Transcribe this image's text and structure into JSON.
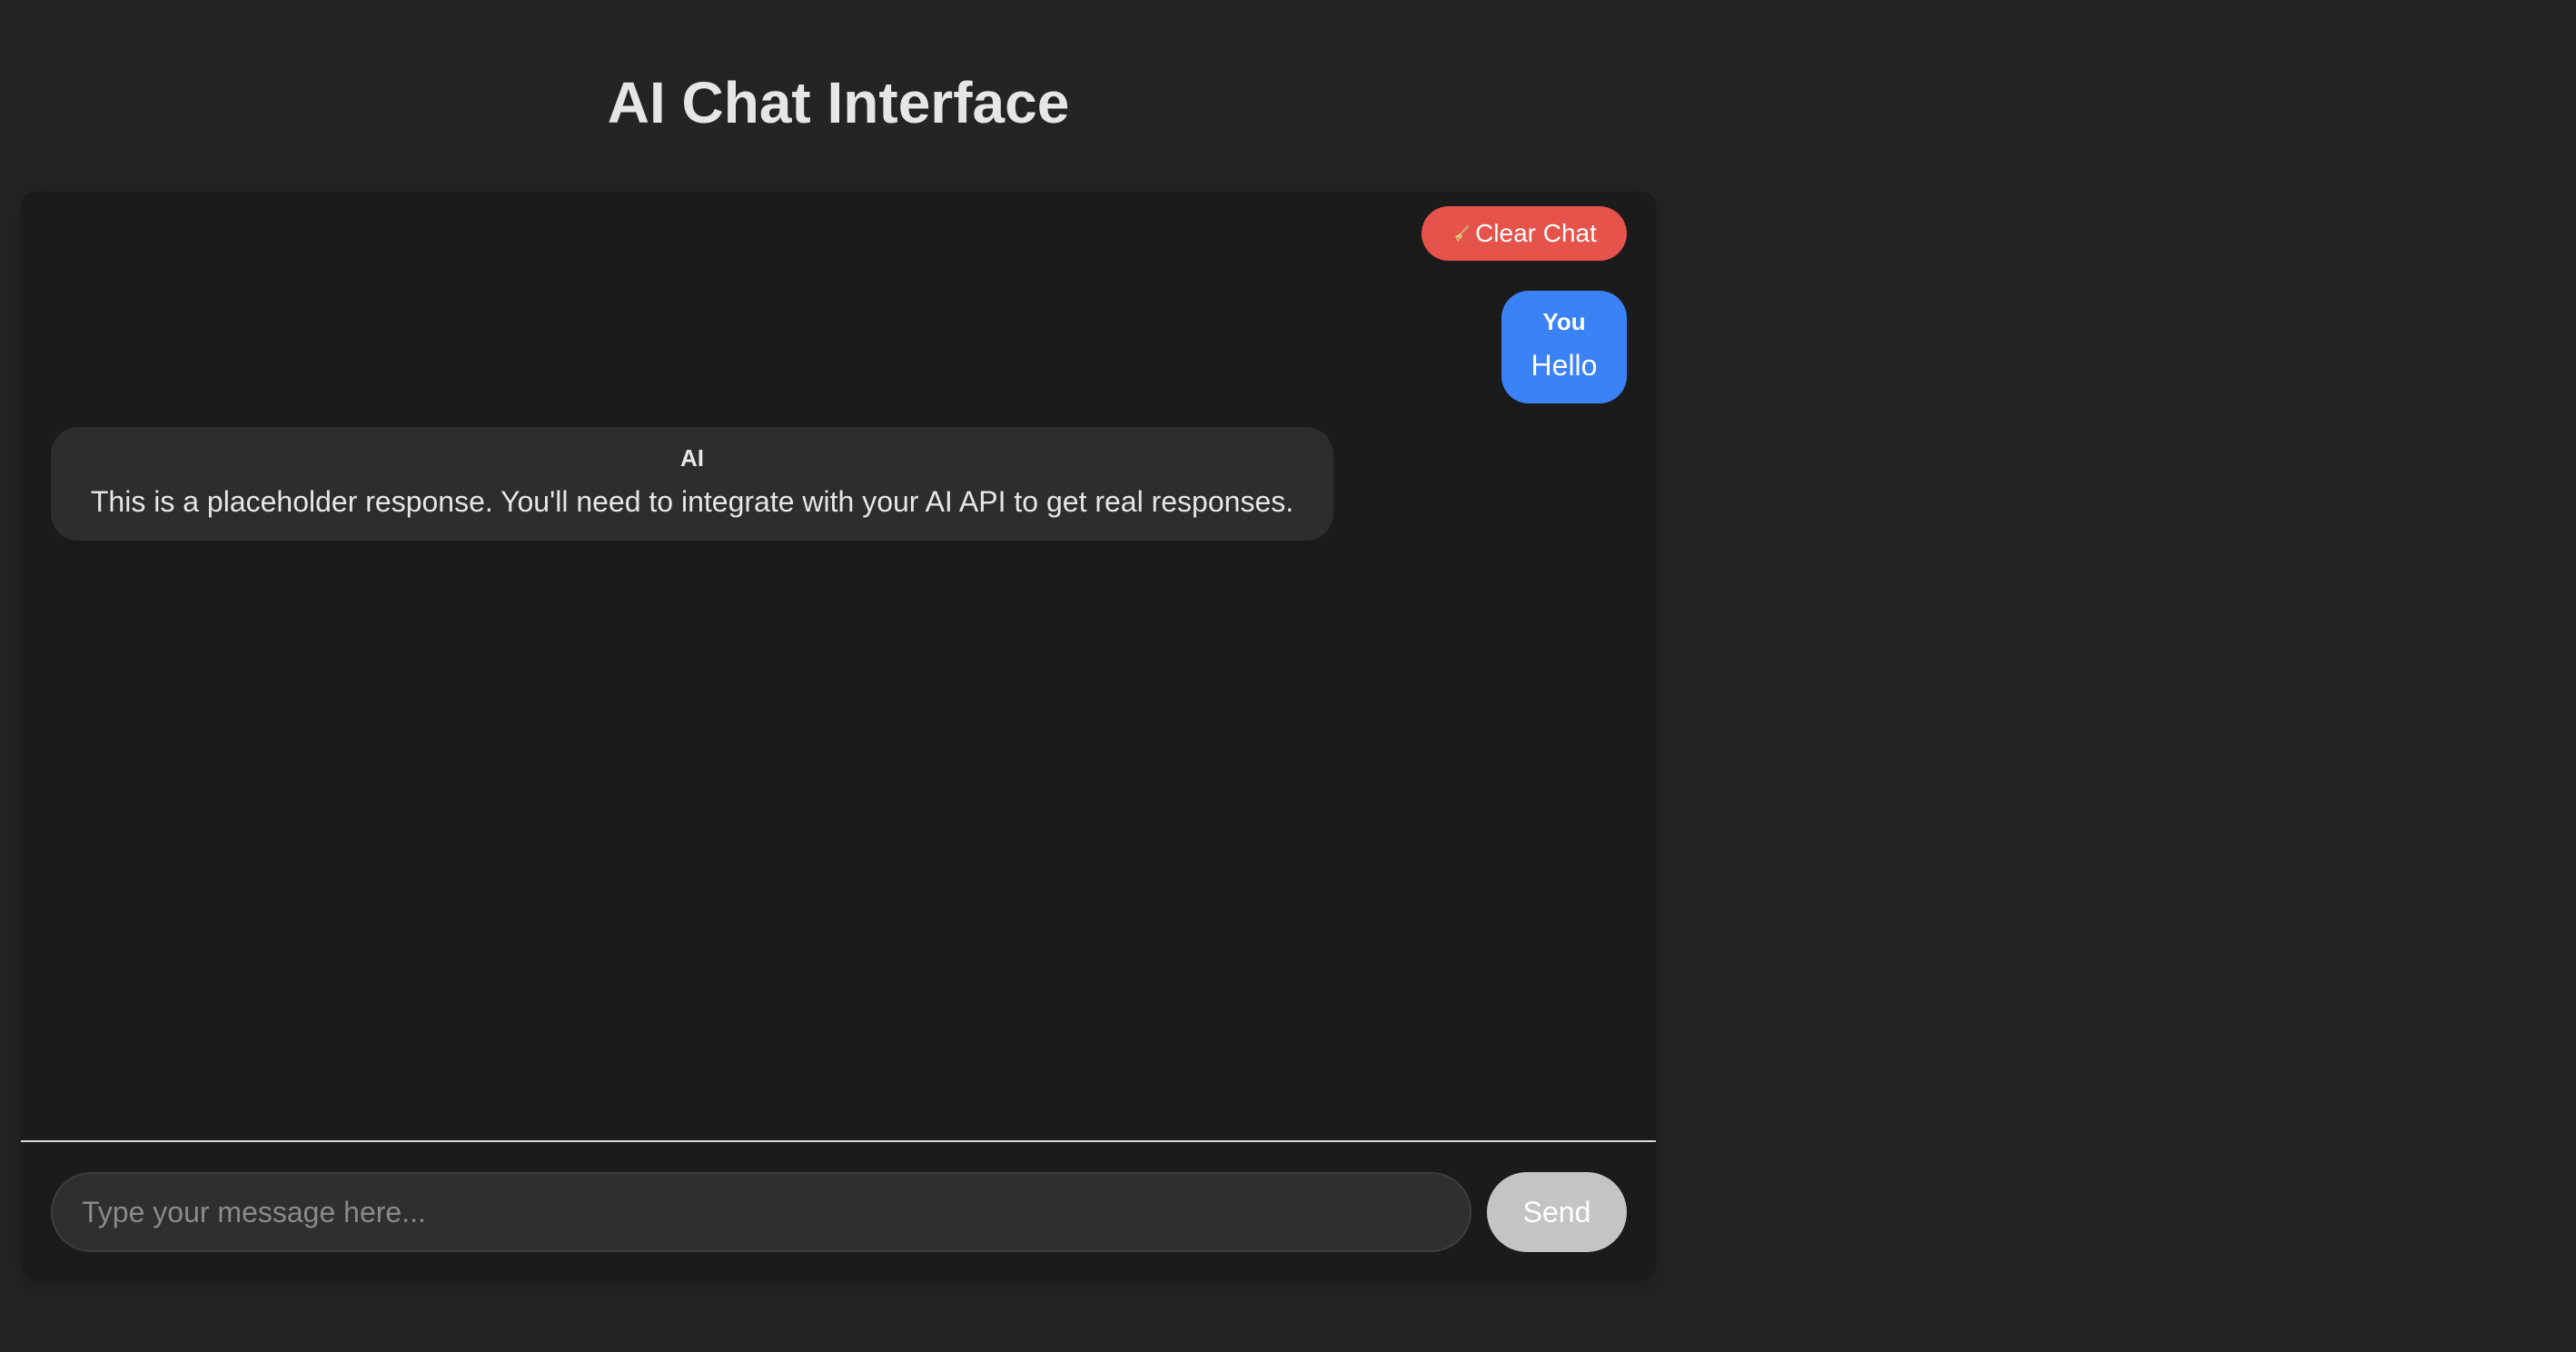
{
  "header": {
    "title": "AI Chat Interface"
  },
  "toolbar": {
    "clear_label": "Clear Chat",
    "clear_icon": "broom-icon"
  },
  "messages": [
    {
      "sender": "You",
      "text": "Hello",
      "role": "user"
    },
    {
      "sender": "AI",
      "text": "This is a placeholder response. You'll need to integrate with your AI API to get real responses.",
      "role": "ai"
    }
  ],
  "composer": {
    "placeholder": "Type your message here...",
    "value": "",
    "send_label": "Send"
  },
  "colors": {
    "page_background": "#242424",
    "chat_background": "#1b1b1b",
    "user_bubble": "#3b82f6",
    "ai_bubble": "#2d2d2d",
    "clear_button": "#e5534b",
    "send_button_disabled": "#c4c4c4"
  }
}
